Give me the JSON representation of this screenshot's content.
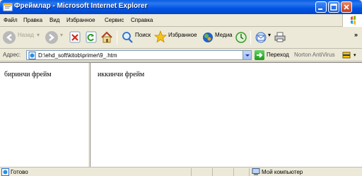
{
  "window": {
    "title": "Фреймлар - Microsoft Internet Explorer"
  },
  "menu": {
    "items": [
      "Файл",
      "Правка",
      "Вид",
      "Избранное",
      "Сервис",
      "Справка"
    ]
  },
  "toolbar": {
    "back_label": "Назад",
    "search_label": "Поиск",
    "favorites_label": "Избранное",
    "media_label": "Медиа"
  },
  "address": {
    "label": "Адрес:",
    "value": "D:\\ehd_soft\\kitob\\primer\\9_.htm",
    "go_label": "Переход",
    "norton_label": "Norton AntiVirus"
  },
  "frames": {
    "left_text": "биринчи фрейм",
    "right_text": "иккинчи фрейм"
  },
  "status": {
    "text": "Готово",
    "zone": "Мой компьютер"
  },
  "colors": {
    "titlebar": "#0054e3",
    "chrome": "#ece9d8"
  }
}
